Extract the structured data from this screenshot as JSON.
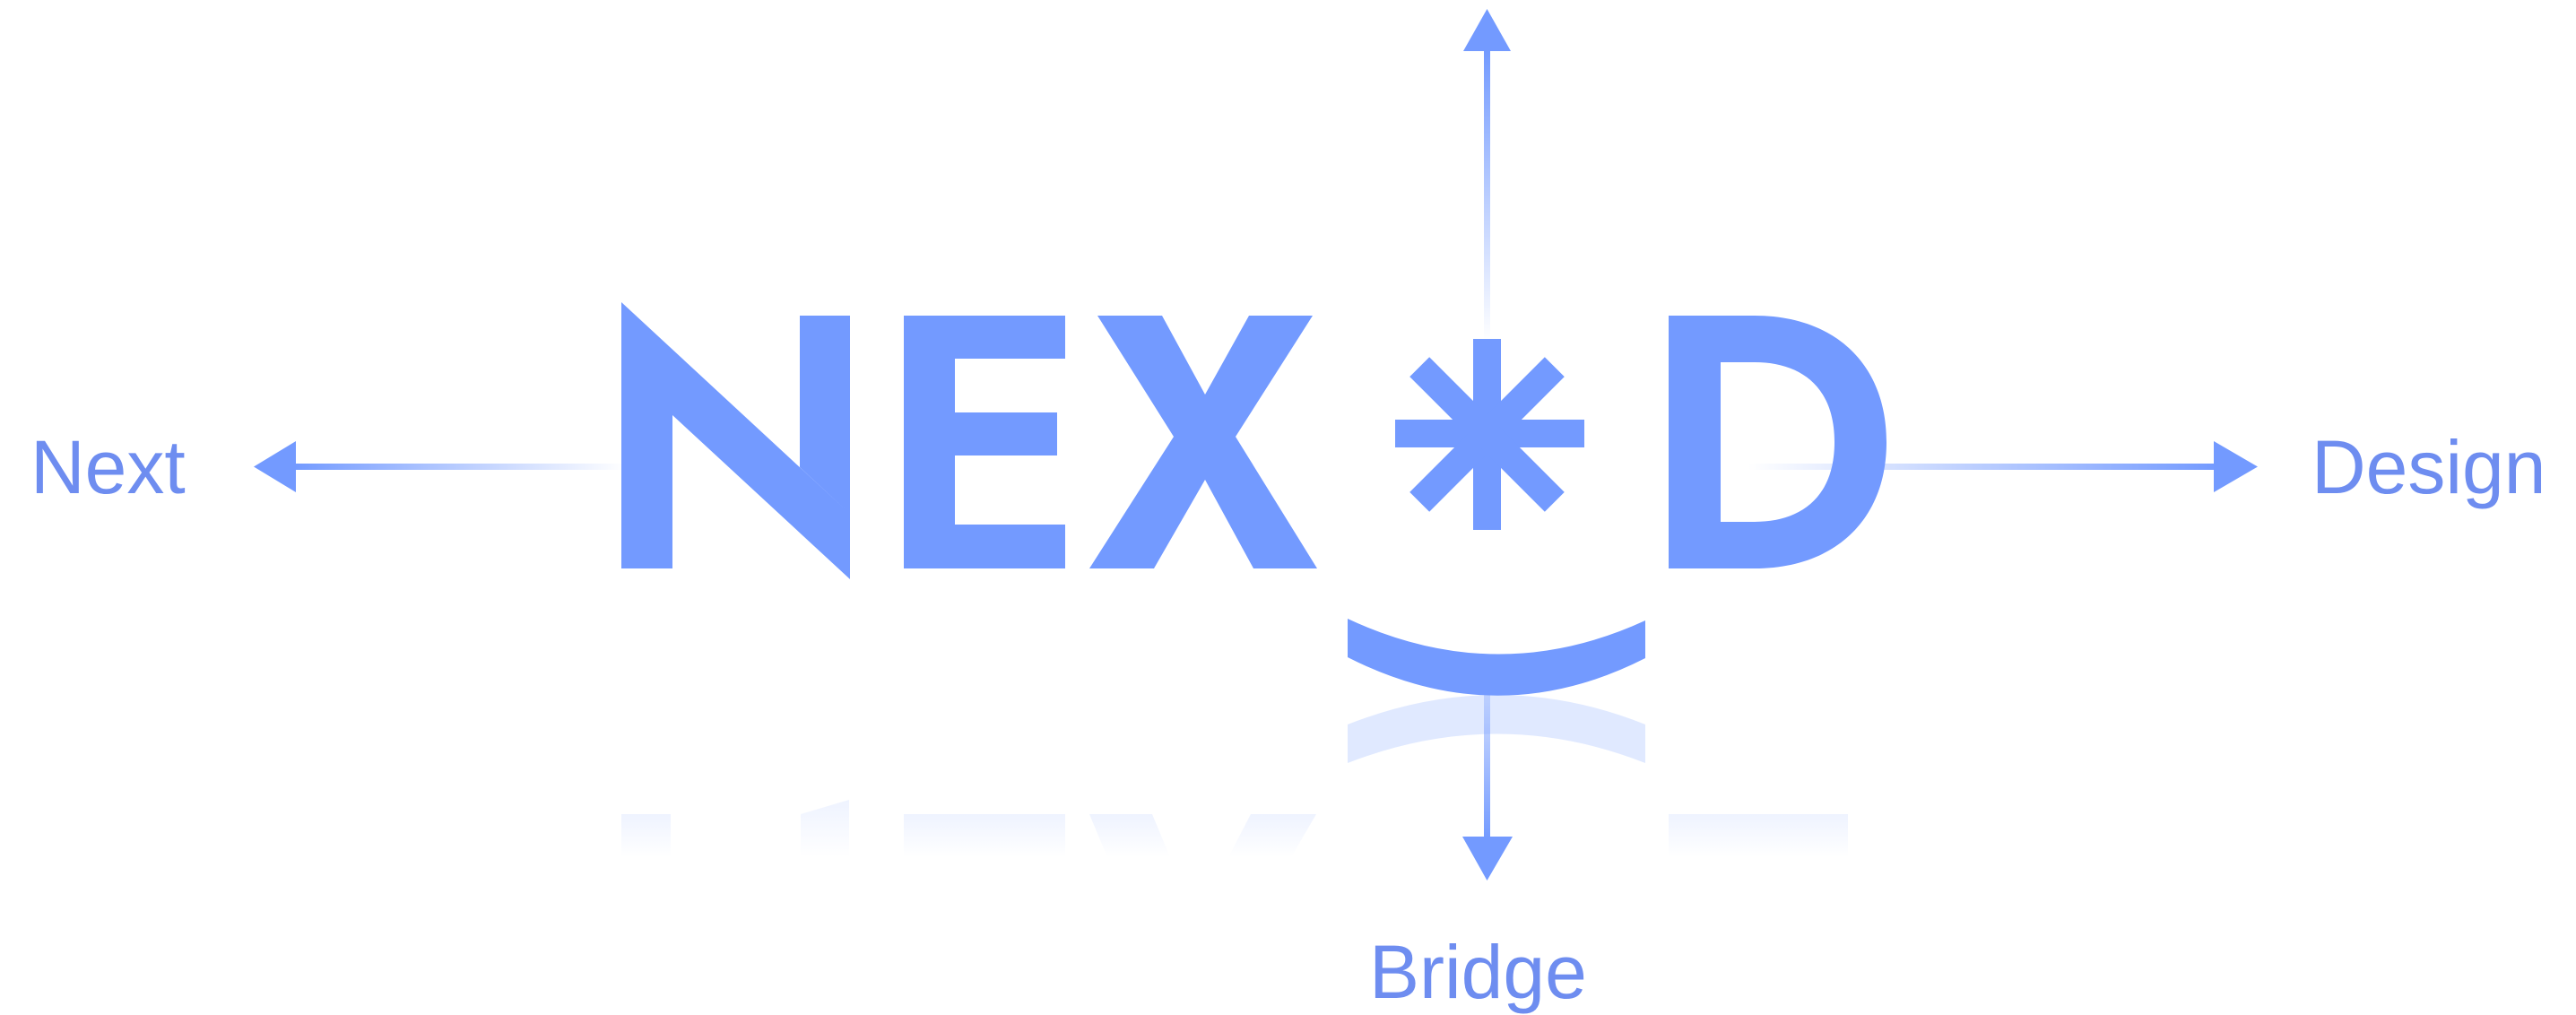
{
  "logo": {
    "letters": [
      "N",
      "E",
      "X",
      "D"
    ],
    "symbol": "asterisk",
    "smile": "smile-arc"
  },
  "labels": {
    "left": "Next",
    "right": "Design",
    "bottom": "Bridge"
  },
  "arrows": {
    "top": "up-arrow",
    "bottom": "down-arrow",
    "left": "left-arrow",
    "right": "right-arrow"
  },
  "colors": {
    "primary": "#739AFF",
    "label": "#6E8DF0",
    "background": "#FFFFFF"
  }
}
